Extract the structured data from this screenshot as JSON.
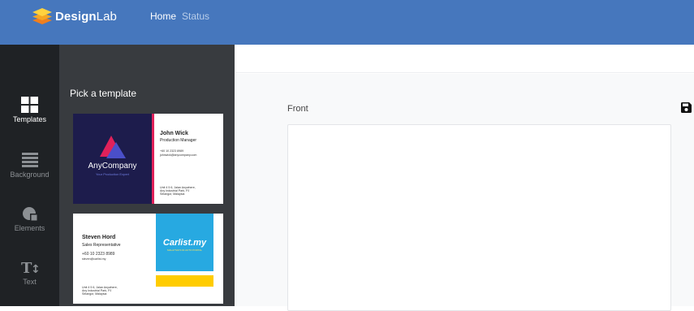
{
  "app": {
    "brand_bold": "Design",
    "brand_light": "Lab",
    "nav": [
      {
        "label": "Home",
        "active": true
      },
      {
        "label": "Status",
        "active": false
      }
    ]
  },
  "rail": [
    {
      "label": "Templates",
      "icon": "grid-icon",
      "active": true
    },
    {
      "label": "Background",
      "icon": "layers-icon",
      "active": false
    },
    {
      "label": "Elements",
      "icon": "shapes-icon",
      "active": false
    },
    {
      "label": "Text",
      "icon": "text-icon",
      "active": false
    }
  ],
  "panel": {
    "title": "Pick a template",
    "templates": [
      {
        "company": "AnyCompany",
        "tagline": "Your Production Expert",
        "name": "John Wick",
        "role": "Production Manager",
        "phone": "+60 10 2323 8989",
        "email": "johnwick@anycompany.com",
        "address": [
          "Unit 4 5 6, Jalan Anywhere,",
          "Any Industrial Park, PJ",
          "Selangor, Malaysia"
        ]
      },
      {
        "name": "Steven Hord",
        "role": "Sales Representative",
        "phone": "+60 10 2323 8989",
        "email": "steven@carlist.my",
        "logo_text": "Carlist.my",
        "logo_sub": "MALAYSIA'S #1 AUTO PORTAL",
        "address": [
          "Unit 4 5 6, Jalan Anywhere,",
          "Any Industrial Park, PJ",
          "Selangor, Malaysia"
        ]
      }
    ]
  },
  "editor": {
    "side_label": "Front",
    "save_icon": "floppy-disk-icon"
  },
  "colors": {
    "topbar": "#4677bd",
    "rail": "#1f2225",
    "panel": "#383b3f",
    "card_navy": "#1d1c4c",
    "card_accent": "#e0215a",
    "carlist_blue": "#27a9e1",
    "carlist_yellow": "#ffcc00"
  }
}
